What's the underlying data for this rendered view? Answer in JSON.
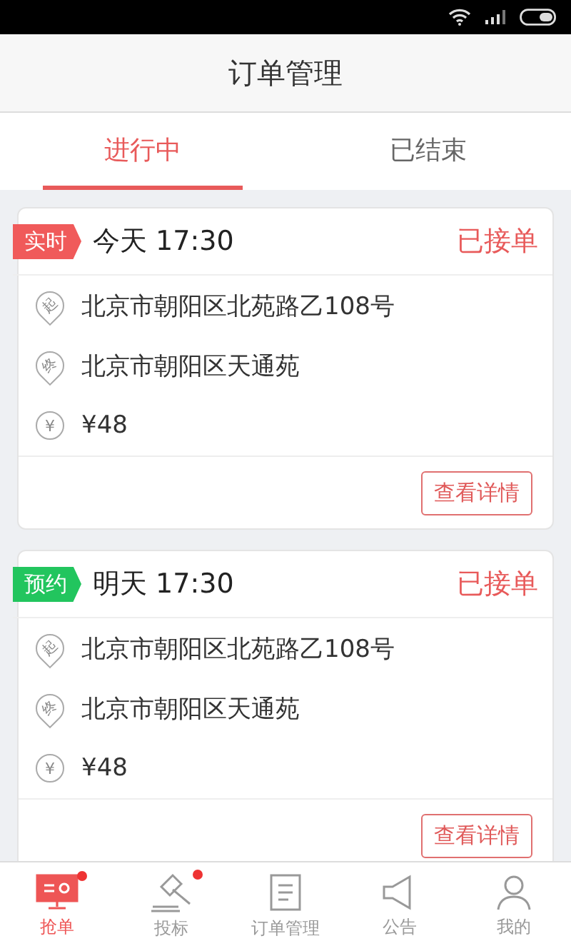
{
  "header": {
    "title": "订单管理"
  },
  "tabs": [
    {
      "label": "进行中",
      "selected": true
    },
    {
      "label": "已结束",
      "selected": false
    }
  ],
  "orders": [
    {
      "tag": "实时",
      "kind": "realtime",
      "time": "今天 17:30",
      "status": "已接单",
      "start": "北京市朝阳区北苑路乙108号",
      "end": "北京市朝阳区天通苑",
      "price": "¥48",
      "start_icon": "起",
      "end_icon": "终",
      "price_icon": "¥",
      "button": "查看详情"
    },
    {
      "tag": "预约",
      "kind": "booked",
      "time": "明天 17:30",
      "status": "已接单",
      "start": "北京市朝阳区北苑路乙108号",
      "end": "北京市朝阳区天通苑",
      "price": "¥48",
      "start_icon": "起",
      "end_icon": "终",
      "price_icon": "¥",
      "button": "查看详情"
    }
  ],
  "nav": [
    {
      "label": "抢单",
      "kind": "grab",
      "selected": true,
      "badge": true
    },
    {
      "label": "投标",
      "kind": "bid",
      "selected": false,
      "badge": true
    },
    {
      "label": "订单管理",
      "kind": "orders",
      "selected": false,
      "badge": false
    },
    {
      "label": "公告",
      "kind": "notice",
      "selected": false,
      "badge": false
    },
    {
      "label": "我的",
      "kind": "me",
      "selected": false,
      "badge": false
    }
  ]
}
